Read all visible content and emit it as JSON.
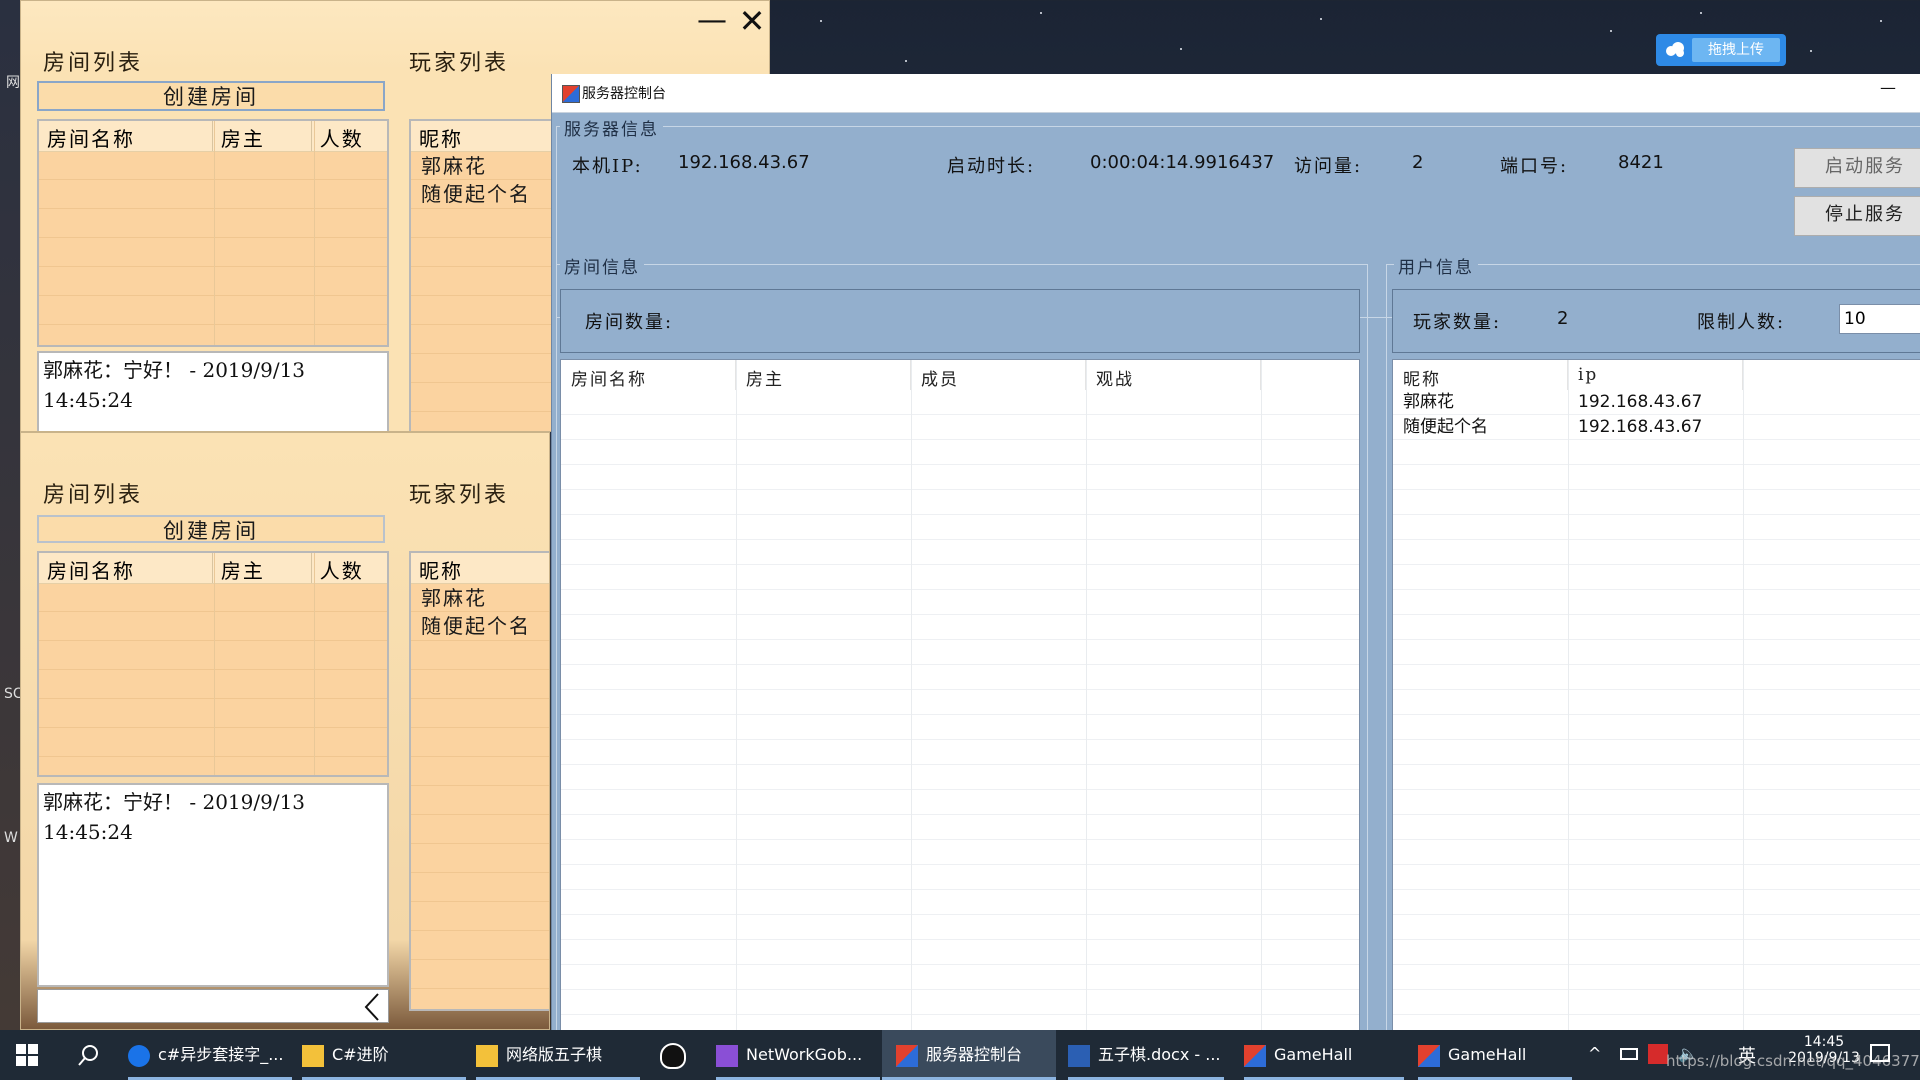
{
  "desktop": {
    "labels": [
      "网",
      "SC",
      "W"
    ],
    "watermark": "https://blog.csdn.net/qq_4046377"
  },
  "upload_widget": {
    "label": "拖拽上传"
  },
  "game_hall_top": {
    "room_list_title": "房间列表",
    "player_list_title": "玩家列表",
    "create_room_button": "创建房间",
    "room_columns": [
      "房间名称",
      "房主",
      "人数"
    ],
    "player_column": "昵称",
    "players": [
      "郭麻花",
      "随便起个名"
    ],
    "chat_line1": "郭麻花：宁好！ - 2019/9/13",
    "chat_line2": "14:45:24",
    "window_controls": {
      "minimize": "—",
      "close": "✕"
    }
  },
  "game_hall_bottom": {
    "room_list_title": "房间列表",
    "player_list_title": "玩家列表",
    "create_room_button": "创建房间",
    "room_columns": [
      "房间名称",
      "房主",
      "人数"
    ],
    "player_column": "昵称",
    "players": [
      "郭麻花",
      "随便起个名"
    ],
    "chat_line1": "郭麻花：宁好！ - 2019/9/13",
    "chat_line2": "14:45:24",
    "input_value": ""
  },
  "server_console": {
    "title": "服务器控制台",
    "minimize": "—",
    "server_info": {
      "group_label": "服务器信息",
      "ip_label": "本机IP:",
      "ip_value": "192.168.43.67",
      "uptime_label": "启动时长:",
      "uptime_value": "0:00:04:14.9916437",
      "visits_label": "访问量:",
      "visits_value": "2",
      "port_label": "端口号:",
      "port_value": "8421",
      "start_button": "启动服务",
      "stop_button": "停止服务"
    },
    "room_info": {
      "group_label": "房间信息",
      "count_label": "房间数量:",
      "count_value": "",
      "columns": [
        "房间名称",
        "房主",
        "成员",
        "观战"
      ]
    },
    "user_info": {
      "group_label": "用户信息",
      "player_count_label": "玩家数量:",
      "player_count_value": "2",
      "limit_label": "限制人数:",
      "limit_value": "10",
      "columns": [
        "昵称",
        "ip"
      ],
      "rows": [
        {
          "name": "郭麻花",
          "ip": "192.168.43.67"
        },
        {
          "name": "随便起个名",
          "ip": "192.168.43.67"
        }
      ]
    }
  },
  "taskbar": {
    "items": [
      "c#异步套接字_...",
      "C#进阶",
      "网络版五子棋",
      "NetWorkGob...",
      "服务器控制台",
      "五子棋.docx - ...",
      "GameHall",
      "GameHall"
    ],
    "ime": "英",
    "time": "14:45",
    "date": "2019/9/13"
  }
}
